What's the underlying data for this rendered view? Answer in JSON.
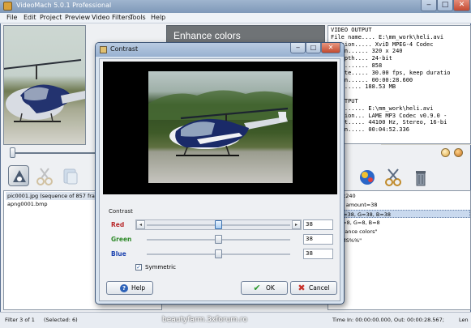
{
  "window": {
    "title": "VideoMach 5.0.1 Professional",
    "minimize_icon": "minimize-icon",
    "maximize_icon": "maximize-icon",
    "close_icon": "close-icon"
  },
  "menu": [
    "File",
    "Edit",
    "Project",
    "Preview",
    "Video Filters",
    "Tools",
    "Help"
  ],
  "enhance_panel": {
    "title": "Enhance colors"
  },
  "info_lines": [
    "VIDEO OUTPUT",
    "File name.... E:\\mm_work\\heli.avi",
    "ression..... XviD MPEG-4 Codec",
    "ution...... 320 x 240",
    "r depth.... 24-bit",
    "es......... 858",
    "e rate..... 30.00 fps, keep duratio",
    "ation...... 00:00:28.600",
    "......... 188.53 MB",
    "",
    "O OUTPUT",
    "name...... E:\\mm_work\\heli.avi",
    "ression... LAME MP3 Codec v0.9.0 -",
    "ormat..... 44100 Hz, Stereo, 16-bi",
    "ation..... 00:04:52.336"
  ],
  "file_list": [
    "pic0001.jpg  (sequence of 857 frames)",
    "apng0001.bmp"
  ],
  "filter_list": [
    "320x240",
    "tion: amount=38",
    "s: R=38, G=38, B=38",
    "s: R=8, G=8, B=8",
    "\"Enhance colors\"",
    "%HMS%%\""
  ],
  "status": {
    "filter": "Filter 3 of 1",
    "selected": "(Selected: 6)",
    "time_in": "Time In: 00:00:00.000,",
    "time_out": "Out: 00:00:28.567;",
    "length": "Len"
  },
  "dialog": {
    "title": "Contrast",
    "group_label": "Contrast",
    "channels": [
      {
        "label": "Red",
        "value": "38",
        "color": "#b8282a",
        "level": 0.5,
        "active": true
      },
      {
        "label": "Green",
        "value": "38",
        "color": "#2f8a2a",
        "level": 0.5,
        "active": false
      },
      {
        "label": "Blue",
        "value": "38",
        "color": "#1d44b0",
        "level": 0.5,
        "active": false
      }
    ],
    "symmetric_label": "Symmetric",
    "symmetric_checked": true,
    "help_label": "Help",
    "ok_label": "OK",
    "cancel_label": "Cancel"
  },
  "watermark": "beautyfarm.3xforum.ro"
}
